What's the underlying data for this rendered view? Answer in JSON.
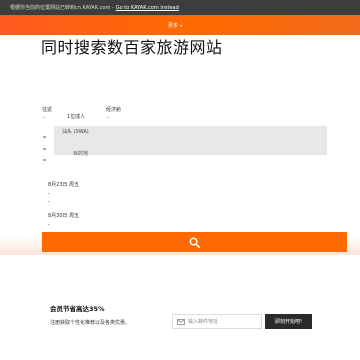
{
  "banner": {
    "message": "根据你当前的位置网站已转到cn.KAYAK.com -",
    "link_label": "Go to KAYAK.com instead"
  },
  "nav": {
    "more_label": "更多",
    "more_icon": "caret-down-icon"
  },
  "hero": {
    "headline": "同时搜索数百家旅游网站"
  },
  "search_form": {
    "trip_type": "往返",
    "travelers": "1位成人",
    "cabin": "经济舱",
    "origin": "汕头 (SWA)",
    "destination": "目的地",
    "depart_date": "8月23日 周五",
    "return_date": "8月30日 周五",
    "search_icon": "search-icon"
  },
  "member": {
    "title": "会员节省高达35%",
    "subtitle": "注册获取个性化推荐以及各类优惠。",
    "email_placeholder": "输入邮件地址",
    "email_icon": "mail-icon",
    "cta_label": "即刻开始吧!"
  },
  "colors": {
    "accent": "#ff6a00",
    "banner_bg": "#3d3d3d",
    "cta_bg": "#2b2b2b"
  }
}
